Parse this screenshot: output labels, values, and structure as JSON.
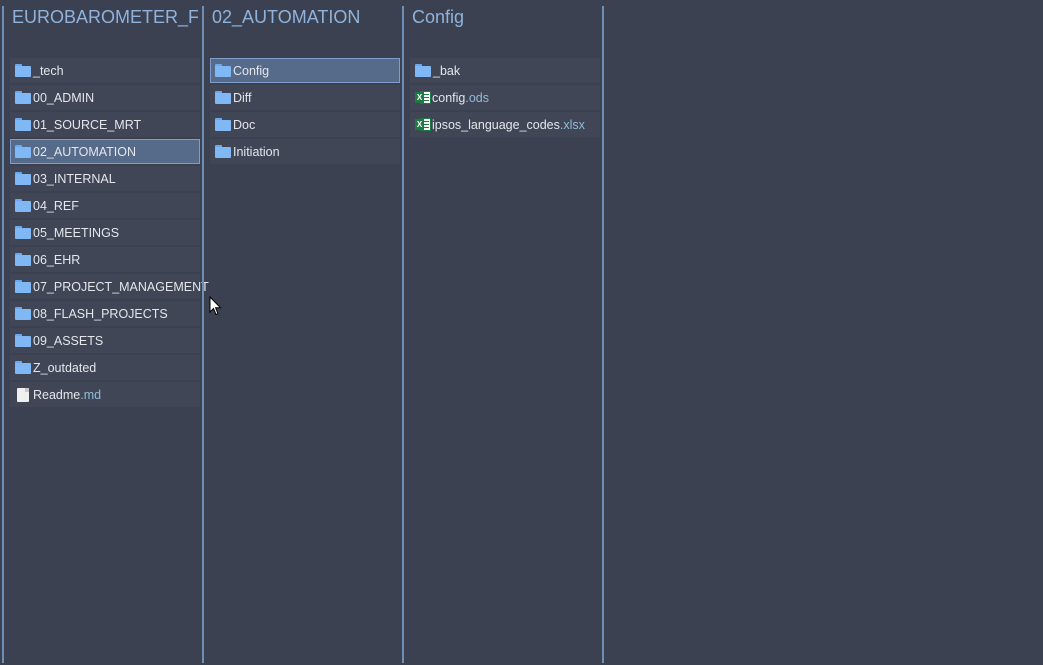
{
  "columns": [
    {
      "title": "EUROBAROMETER_FL...",
      "items": [
        {
          "name": "_tech",
          "ext": "",
          "type": "folder"
        },
        {
          "name": "00_ADMIN",
          "ext": "",
          "type": "folder"
        },
        {
          "name": "01_SOURCE_MRT",
          "ext": "",
          "type": "folder"
        },
        {
          "name": "02_AUTOMATION",
          "ext": "",
          "type": "folder",
          "selected": true
        },
        {
          "name": "03_INTERNAL",
          "ext": "",
          "type": "folder"
        },
        {
          "name": "04_REF",
          "ext": "",
          "type": "folder"
        },
        {
          "name": "05_MEETINGS",
          "ext": "",
          "type": "folder"
        },
        {
          "name": "06_EHR",
          "ext": "",
          "type": "folder"
        },
        {
          "name": "07_PROJECT_MANAGEMENT",
          "ext": "",
          "type": "folder"
        },
        {
          "name": "08_FLASH_PROJECTS",
          "ext": "",
          "type": "folder"
        },
        {
          "name": "09_ASSETS",
          "ext": "",
          "type": "folder"
        },
        {
          "name": "Z_outdated",
          "ext": "",
          "type": "folder"
        },
        {
          "name": "Readme",
          "ext": ".md",
          "type": "file"
        }
      ]
    },
    {
      "title": "02_AUTOMATION",
      "items": [
        {
          "name": "Config",
          "ext": "",
          "type": "folder",
          "selected": true
        },
        {
          "name": "Diff",
          "ext": "",
          "type": "folder"
        },
        {
          "name": "Doc",
          "ext": "",
          "type": "folder"
        },
        {
          "name": "Initiation",
          "ext": "",
          "type": "folder"
        }
      ]
    },
    {
      "title": "Config",
      "items": [
        {
          "name": "_bak",
          "ext": "",
          "type": "folder"
        },
        {
          "name": "config",
          "ext": ".ods",
          "type": "spreadsheet"
        },
        {
          "name": "ipsos_language_codes",
          "ext": ".xlsx",
          "type": "spreadsheet"
        }
      ]
    }
  ],
  "colors": {
    "background": "#3b4150",
    "row": "#404656",
    "selected": "#566a8a",
    "divider": "#6f8eb6",
    "title": "#8fb3dc",
    "extension": "#8fbcd8"
  }
}
